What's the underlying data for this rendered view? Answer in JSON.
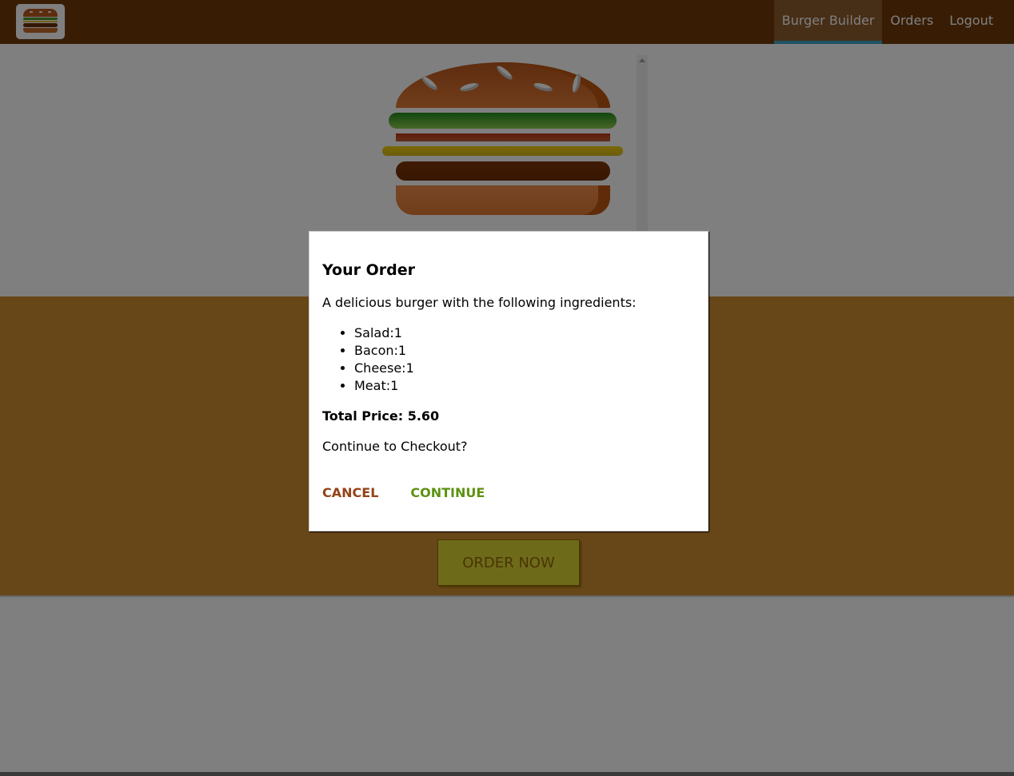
{
  "toolbar": {
    "logo_icon": "burger-logo-icon",
    "nav": [
      {
        "label": "Burger Builder",
        "active": true
      },
      {
        "label": "Orders",
        "active": false
      },
      {
        "label": "Logout",
        "active": false
      }
    ],
    "colors": {
      "background": "#703b09",
      "active_bg": "#8f5c2c",
      "active_underline": "#40a4c8"
    }
  },
  "burger": {
    "ingredients": [
      "salad",
      "bacon",
      "cheese",
      "meat"
    ]
  },
  "controls": {
    "order_button_label": "ORDER NOW",
    "background": "#cf8f2e",
    "order_button_color": "#dad735"
  },
  "modal": {
    "title": "Your Order",
    "intro": "A delicious burger with the following ingredients:",
    "ingredients": [
      "Salad:1",
      "Bacon:1",
      "Cheese:1",
      "Meat:1"
    ],
    "total_price_text": "Total Price: 5.60",
    "prompt": "Continue to Checkout?",
    "cancel_label": "CANCEL",
    "continue_label": "CONTINUE",
    "colors": {
      "cancel": "#944317",
      "continue": "#5c9210"
    }
  }
}
